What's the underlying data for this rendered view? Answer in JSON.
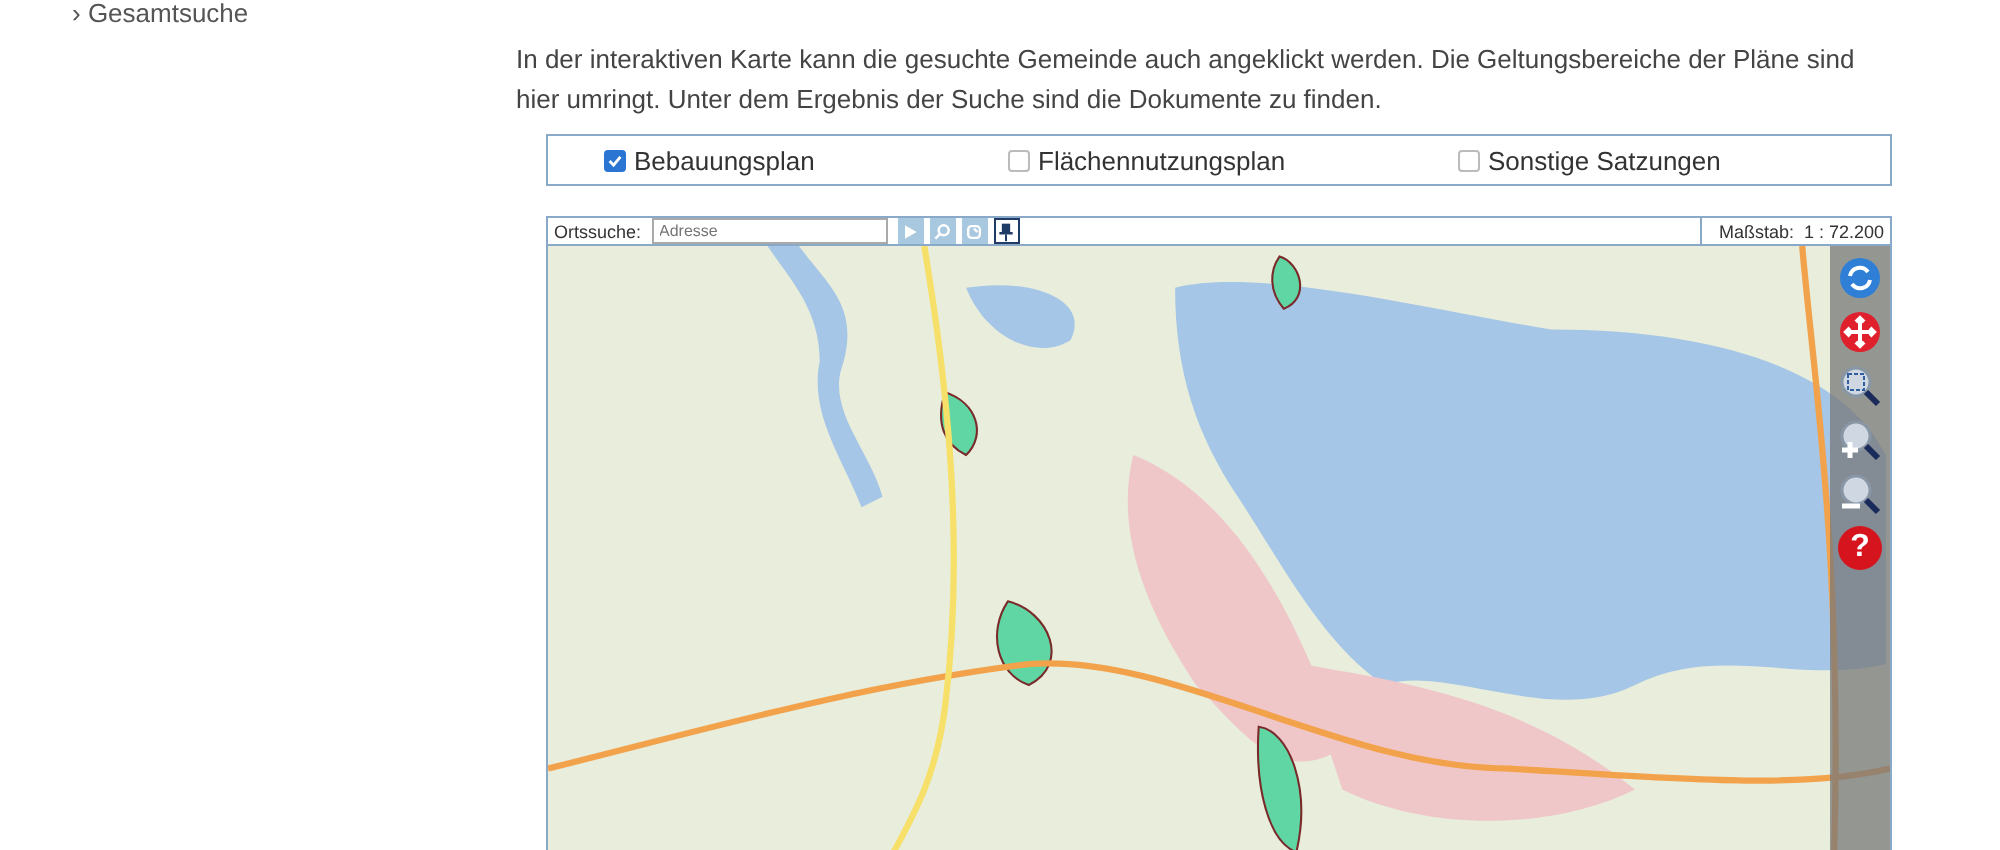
{
  "breadcrumb": "› Gesamtsuche",
  "intro": "In der interaktiven Karte kann die gesuchte Gemeinde auch angeklickt werden. Die Geltungsbereiche der Pläne sind hier umringt. Unter dem Ergebnis der Suche sind die Dokumente zu finden.",
  "filters": [
    {
      "label": "Bebauungsplan",
      "checked": true
    },
    {
      "label": "Flächennutzungsplan",
      "checked": false
    },
    {
      "label": "Sonstige Satzungen",
      "checked": false
    }
  ],
  "map": {
    "search_label": "Ortssuche:",
    "search_placeholder": "Adresse",
    "tools": [
      {
        "kind": "play",
        "disabled": true
      },
      {
        "kind": "search",
        "disabled": true
      },
      {
        "kind": "refresh",
        "disabled": true
      },
      {
        "kind": "pin",
        "disabled": false
      }
    ],
    "scale": "Maßstab:  1 : 72.200",
    "controls": [
      {
        "kind": "reload"
      },
      {
        "kind": "pan"
      },
      {
        "kind": "zoom-box"
      },
      {
        "kind": "zoom-in"
      },
      {
        "kind": "zoom-out"
      },
      {
        "kind": "help",
        "label": "?"
      }
    ]
  }
}
